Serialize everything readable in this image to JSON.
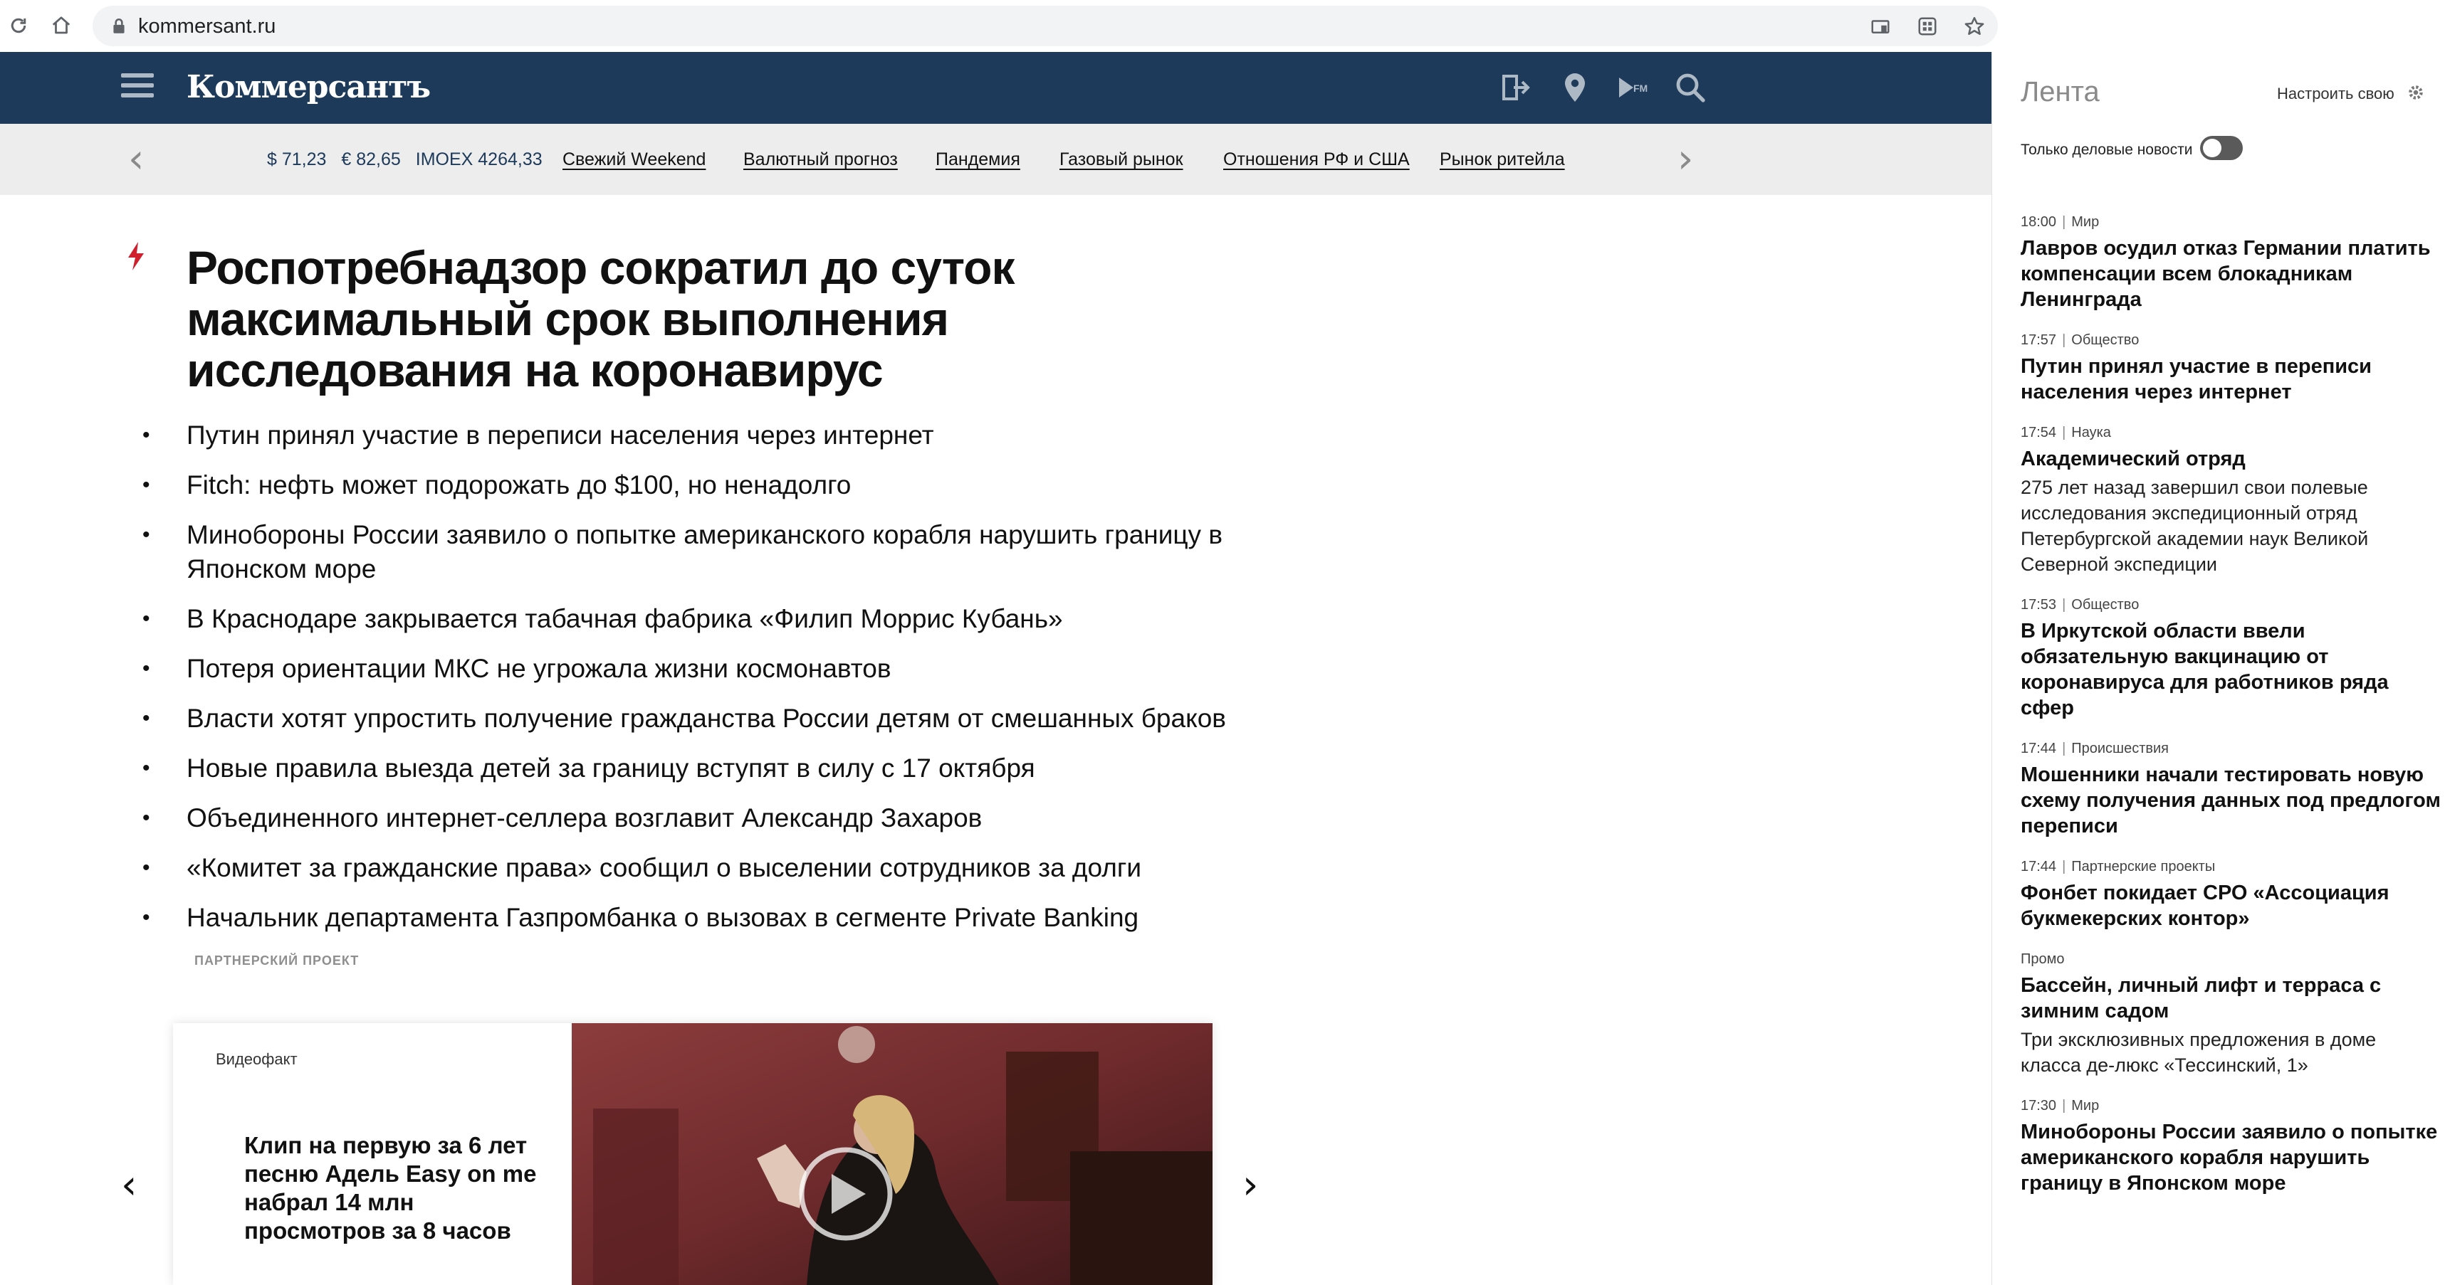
{
  "browser": {
    "url": "kommersant.ru"
  },
  "site": {
    "logo": "Коммерсантъ"
  },
  "ticker": {
    "usd": "$ 71,23",
    "eur": "€ 82,65",
    "imoex": "IMOEX 4264,33",
    "tags": [
      "Свежий Weekend",
      "Валютный прогноз",
      "Пандемия",
      "Газовый рынок",
      "Отношения РФ и США",
      "Рынок ритейла"
    ]
  },
  "main": {
    "headline": "Роспотребнадзор сократил до суток максимальный срок выполнения исследования на коронавирус",
    "news": [
      "Путин принял участие в переписи населения через интернет",
      "Fitch: нефть может подорожать до $100, но ненадолго",
      "Минобороны России заявило о попытке американского корабля нарушить границу в Японском море",
      "В Краснодаре закрывается табачная фабрика «Филип Моррис Кубань»",
      "Потеря ориентации МКС не угрожала жизни космонавтов",
      "Власти хотят упростить получение гражданства России детям от смешанных браков",
      "Новые правила выезда детей за границу вступят в силу с 17 октября",
      "Объединенного интернет-селлера возглавит Александр Захаров",
      "«Комитет за гражданские права» сообщил о выселении сотрудников за долги",
      "Начальник департамента Газпромбанка о вызовах в сегменте Private Banking"
    ],
    "partner_label": "ПАРТНЕРСКИЙ ПРОЕКТ",
    "video": {
      "label": "Видеофакт",
      "title": "Клип на первую за 6 лет песню Адель Easy on me набрал 14 млн просмотров за 8 часов"
    }
  },
  "feed": {
    "title": "Лента",
    "configure": "Настроить свою",
    "only_business": "Только деловые новости",
    "items": [
      {
        "time": "18:00",
        "section": "Мир",
        "title": "Лавров осудил отказ Германии платить компенсации всем блокадникам Ленинграда",
        "desc": ""
      },
      {
        "time": "17:57",
        "section": "Общество",
        "title": "Путин принял участие в переписи населения через интернет",
        "desc": ""
      },
      {
        "time": "17:54",
        "section": "Наука",
        "title": "Академический отряд",
        "desc": "275 лет назад завершил свои полевые исследования экспедиционный отряд Петербургской академии наук Великой Северной экспедиции"
      },
      {
        "time": "17:53",
        "section": "Общество",
        "title": "В Иркутской области ввели обязательную вакцинацию от коронавируса для работников ряда сфер",
        "desc": ""
      },
      {
        "time": "17:44",
        "section": "Происшествия",
        "title": "Мошенники начали тестировать новую схему получения данных под предлогом переписи",
        "desc": ""
      },
      {
        "time": "17:44",
        "section": "Партнерские проекты",
        "title": "Фонбет покидает СРО «Ассоциация букмекерских контор»",
        "desc": ""
      },
      {
        "time": "",
        "section": "Промо",
        "title": "Бассейн, личный лифт и терраса с зимним садом",
        "desc": "Три эксклюзивных предложения в доме класса де-люкс «Тессинский, 1»"
      },
      {
        "time": "17:30",
        "section": "Мир",
        "title": "Минобороны России заявило о попытке американского корабля нарушить границу в Японском море",
        "desc": ""
      }
    ]
  }
}
